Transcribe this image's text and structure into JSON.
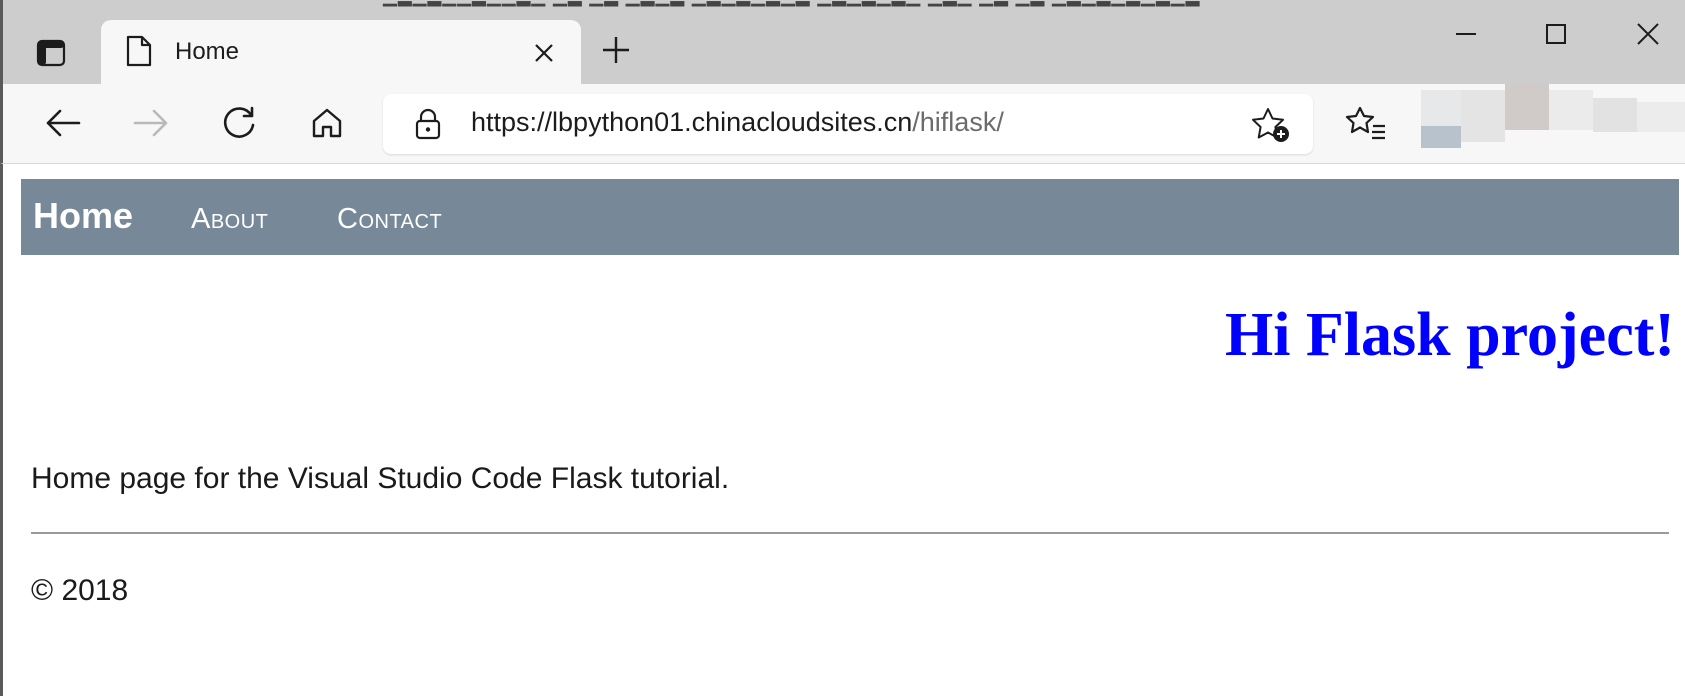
{
  "browser": {
    "tab_title": "Home",
    "url_host": "https://lbpython01.chinacloudsites.cn",
    "url_path": "/hiflask/",
    "icons": {
      "tab_actions": "tab-actions-icon",
      "favicon": "page-icon",
      "tab_close": "close-icon",
      "new_tab": "plus-icon",
      "minimize": "minimize-icon",
      "maximize": "maximize-icon",
      "window_close": "close-icon",
      "back": "back-arrow-icon",
      "forward": "forward-arrow-icon",
      "refresh": "refresh-icon",
      "home": "home-icon",
      "lock": "lock-icon",
      "add_favorite": "star-plus-icon",
      "favorites": "favorites-list-icon"
    }
  },
  "page": {
    "nav": {
      "home": "Home",
      "about": "About",
      "contact": "Contact"
    },
    "heading": "Hi Flask project!",
    "intro": "Home page for the Visual Studio Code Flask tutorial.",
    "footer": "© 2018"
  },
  "colors": {
    "navbar_bg": "#778899",
    "heading": "#0000ff",
    "tabstrip_bg": "#cdcdcd",
    "toolbar_bg": "#f7f7f7"
  }
}
